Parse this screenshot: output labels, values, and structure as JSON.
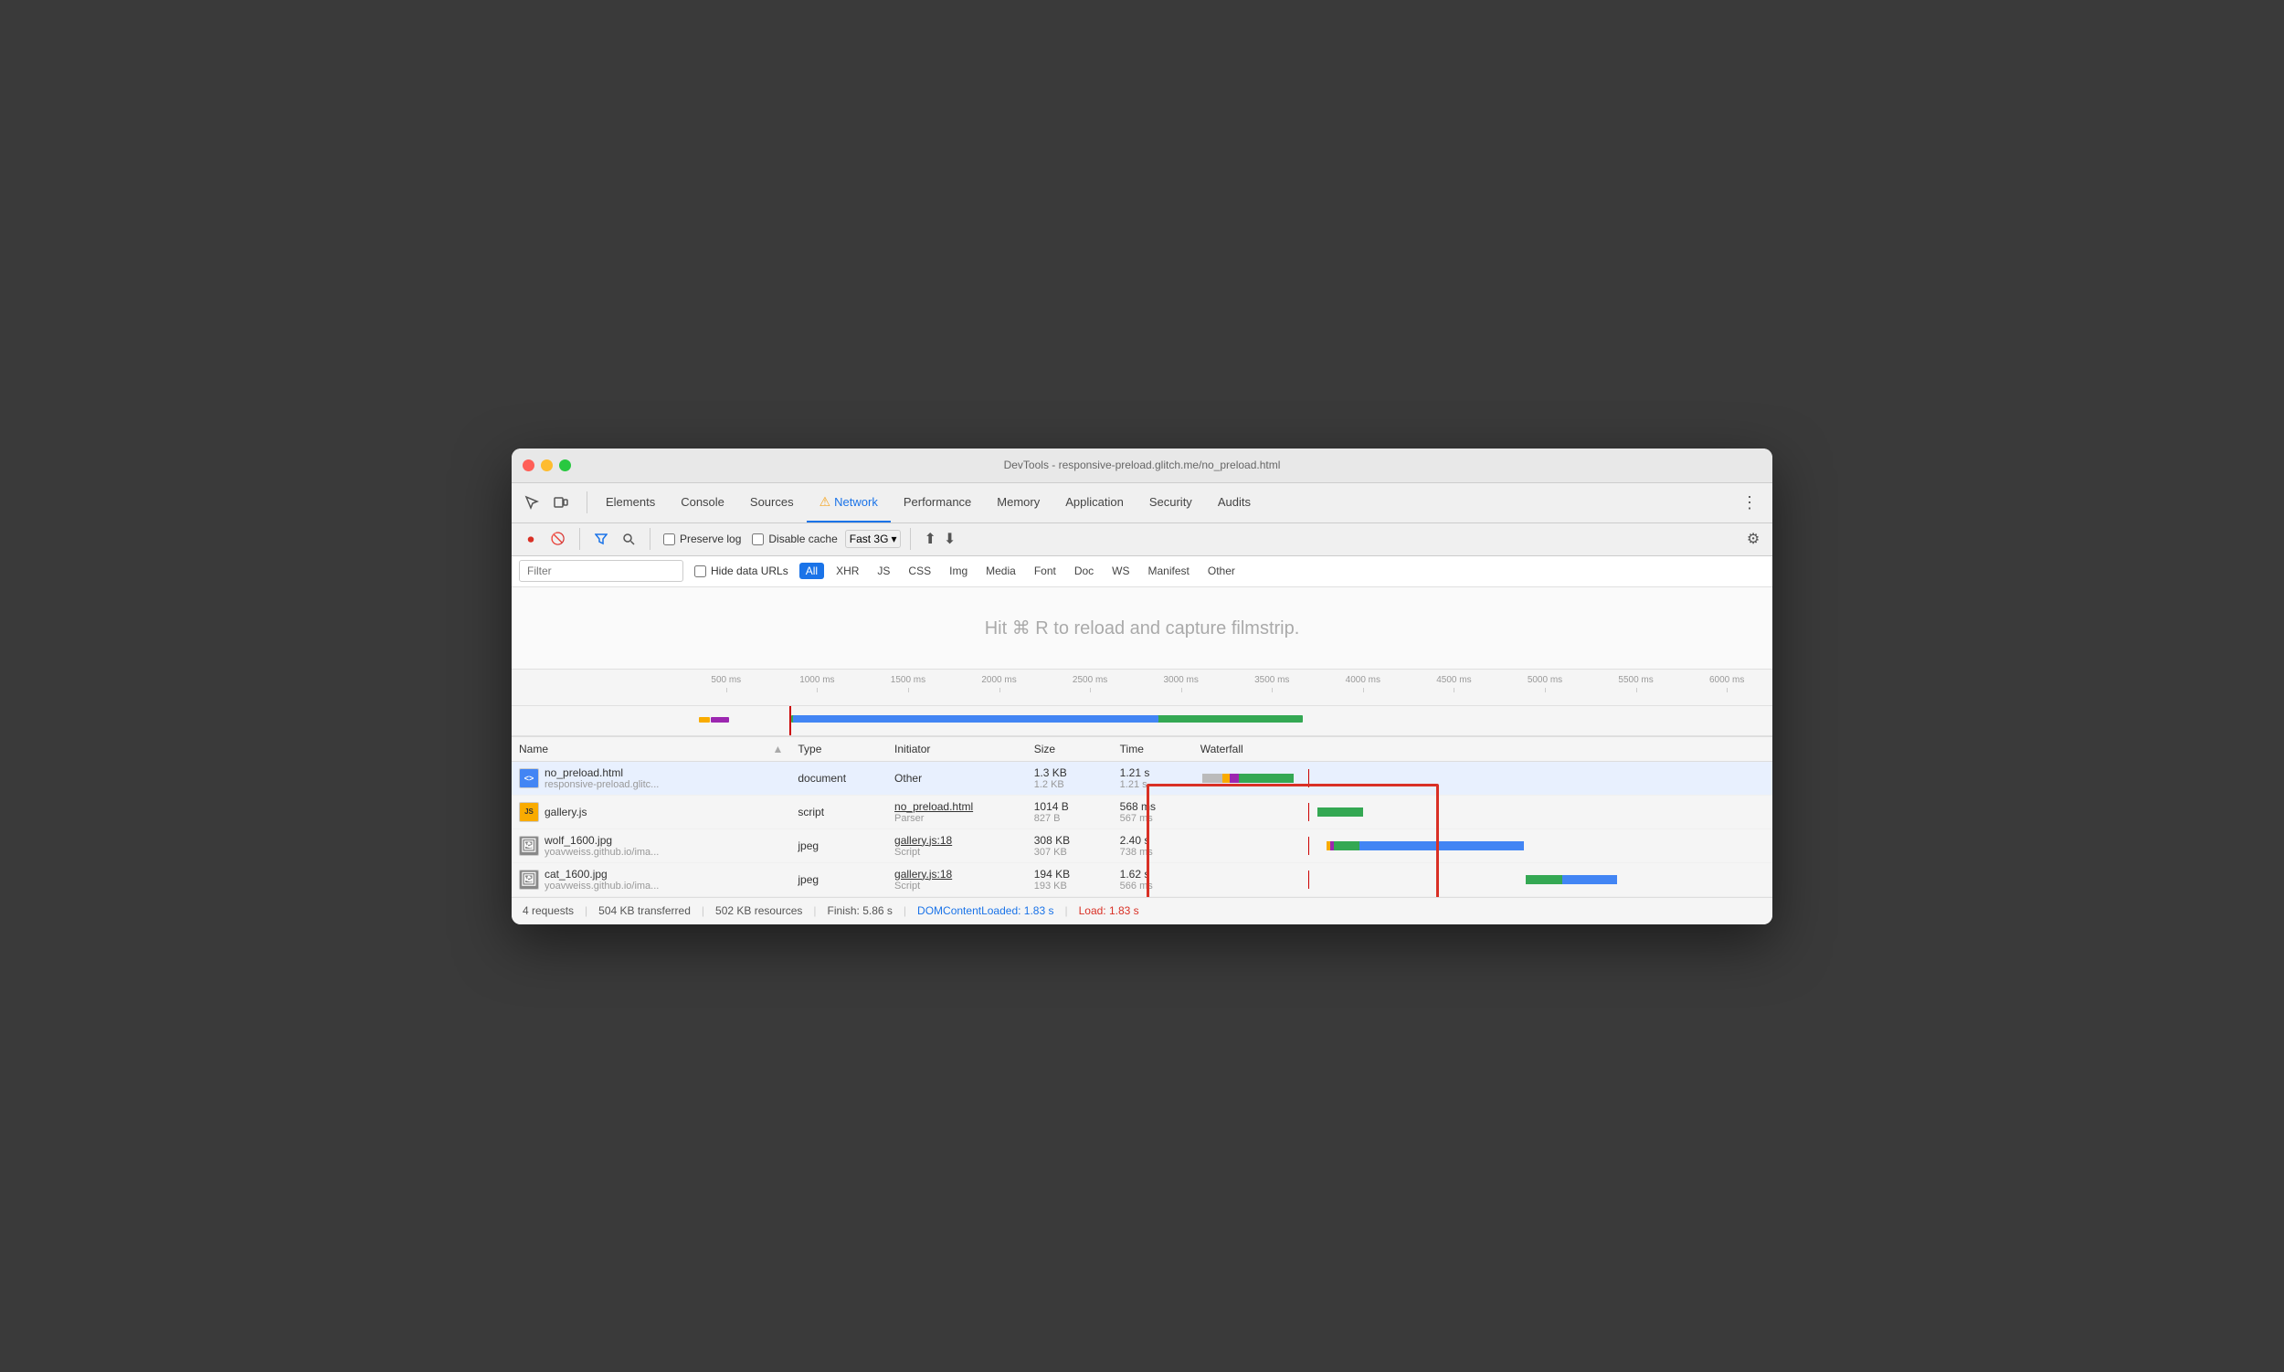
{
  "window": {
    "title": "DevTools - responsive-preload.glitch.me/no_preload.html"
  },
  "nav": {
    "tabs": [
      {
        "label": "Elements",
        "active": false
      },
      {
        "label": "Console",
        "active": false
      },
      {
        "label": "Sources",
        "active": false
      },
      {
        "label": "Network",
        "active": true,
        "warning": true
      },
      {
        "label": "Performance",
        "active": false
      },
      {
        "label": "Memory",
        "active": false
      },
      {
        "label": "Application",
        "active": false
      },
      {
        "label": "Security",
        "active": false
      },
      {
        "label": "Audits",
        "active": false
      }
    ]
  },
  "toolbar": {
    "preserve_log": "Preserve log",
    "disable_cache": "Disable cache",
    "throttle": "Fast 3G"
  },
  "filter": {
    "placeholder": "Filter",
    "hide_data_urls": "Hide data URLs",
    "tags": [
      "All",
      "XHR",
      "JS",
      "CSS",
      "Img",
      "Media",
      "Font",
      "Doc",
      "WS",
      "Manifest",
      "Other"
    ]
  },
  "filmstrip": {
    "hint": "Hit ⌘ R to reload and capture filmstrip."
  },
  "ruler": {
    "ticks": [
      "500 ms",
      "1000 ms",
      "1500 ms",
      "2000 ms",
      "2500 ms",
      "3000 ms",
      "3500 ms",
      "4000 ms",
      "4500 ms",
      "5000 ms",
      "5500 ms",
      "6000 ms"
    ]
  },
  "table": {
    "headers": [
      "Name",
      "Type",
      "Initiator",
      "Size",
      "Time",
      "Waterfall"
    ],
    "rows": [
      {
        "name": "no_preload.html",
        "url": "responsive-preload.glitc...",
        "type": "document",
        "initiator_main": "Other",
        "initiator_sub": "",
        "size_main": "1.3 KB",
        "size_sub": "1.2 KB",
        "time_main": "1.21 s",
        "time_sub": "1.21 s",
        "icon_type": "html",
        "icon_text": "<>",
        "selected": true
      },
      {
        "name": "gallery.js",
        "url": "",
        "type": "script",
        "initiator_main": "no_preload.html",
        "initiator_sub": "Parser",
        "size_main": "1014 B",
        "size_sub": "827 B",
        "time_main": "568 ms",
        "time_sub": "567 ms",
        "icon_type": "js",
        "icon_text": "JS",
        "selected": false
      },
      {
        "name": "wolf_1600.jpg",
        "url": "yoavweiss.github.io/ima...",
        "type": "jpeg",
        "initiator_main": "gallery.js:18",
        "initiator_sub": "Script",
        "size_main": "308 KB",
        "size_sub": "307 KB",
        "time_main": "2.40 s",
        "time_sub": "738 ms",
        "icon_type": "jpg",
        "icon_text": "🖼",
        "selected": false
      },
      {
        "name": "cat_1600.jpg",
        "url": "yoavweiss.github.io/ima...",
        "type": "jpeg",
        "initiator_main": "gallery.js:18",
        "initiator_sub": "Script",
        "size_main": "194 KB",
        "size_sub": "193 KB",
        "time_main": "1.62 s",
        "time_sub": "566 ms",
        "icon_type": "jpg",
        "icon_text": "🖼",
        "selected": false
      }
    ]
  },
  "status": {
    "requests": "4 requests",
    "transferred": "504 KB transferred",
    "resources": "502 KB resources",
    "finish": "Finish: 5.86 s",
    "domcontent": "DOMContentLoaded: 1.83 s",
    "load": "Load: 1.83 s"
  }
}
